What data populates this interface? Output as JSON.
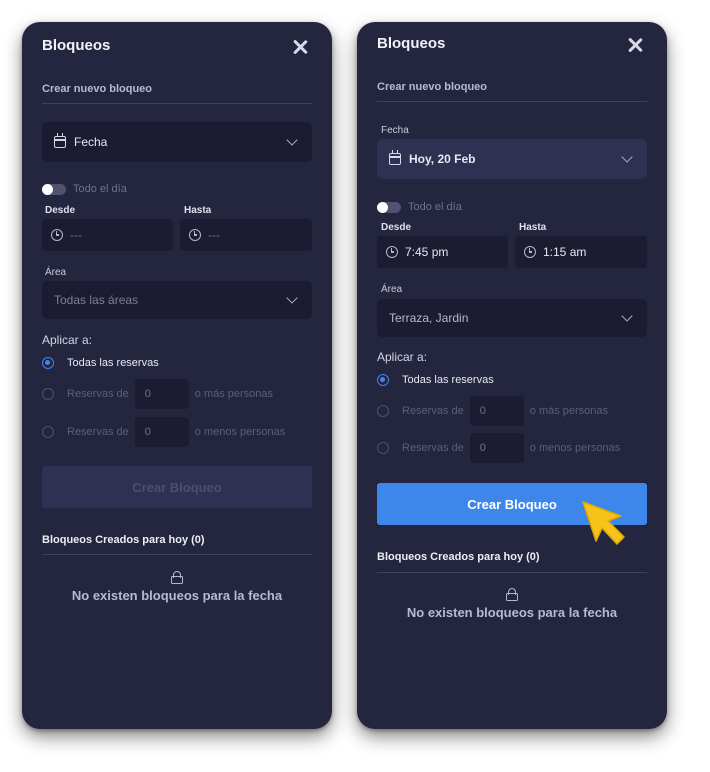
{
  "panels": [
    {
      "title": "Bloqueos",
      "section_title": "Crear nuevo bloqueo",
      "date_label": "",
      "date_value": "Fecha",
      "allday_label": "Todo el día",
      "from_label": "Desde",
      "to_label": "Hasta",
      "from_value": "---",
      "to_value": "---",
      "area_label": "Área",
      "area_value": "Todas las áreas",
      "apply_label": "Aplicar a:",
      "radio_all": "Todas las reservas",
      "radio_prefix": "Reservas de",
      "radio_more_value": "0",
      "radio_more_suffix": "o más personas",
      "radio_less_value": "0",
      "radio_less_suffix": "o menos personas",
      "create_button": "Crear Bloqueo",
      "button_state": "disabled",
      "created_header": "Bloqueos Creados para hoy (0)",
      "empty_message": "No existen bloqueos para la fecha"
    },
    {
      "title": "Bloqueos",
      "section_title": "Crear nuevo bloqueo",
      "date_label": "Fecha",
      "date_value": "Hoy, 20 Feb",
      "allday_label": "Todo el día",
      "from_label": "Desde",
      "to_label": "Hasta",
      "from_value": "7:45 pm",
      "to_value": "1:15 am",
      "area_label": "Área",
      "area_value": "Terraza, Jardin",
      "apply_label": "Aplicar a:",
      "radio_all": "Todas las reservas",
      "radio_prefix": "Reservas de",
      "radio_more_value": "0",
      "radio_more_suffix": "o más personas",
      "radio_less_value": "0",
      "radio_less_suffix": "o menos personas",
      "create_button": "Crear Bloqueo",
      "button_state": "enabled",
      "created_header": "Bloqueos Creados para hoy (0)",
      "empty_message": "No existen bloqueos para la fecha"
    }
  ],
  "colors": {
    "panel_bg": "#24253f",
    "field_bg": "#1b1c31",
    "accent_blue": "#3d86ea",
    "cursor_yellow": "#f7c21a"
  },
  "icons": [
    "close-icon",
    "calendar-icon",
    "chevron-down-icon",
    "clock-icon",
    "lock-icon",
    "pointer-cursor-icon"
  ]
}
